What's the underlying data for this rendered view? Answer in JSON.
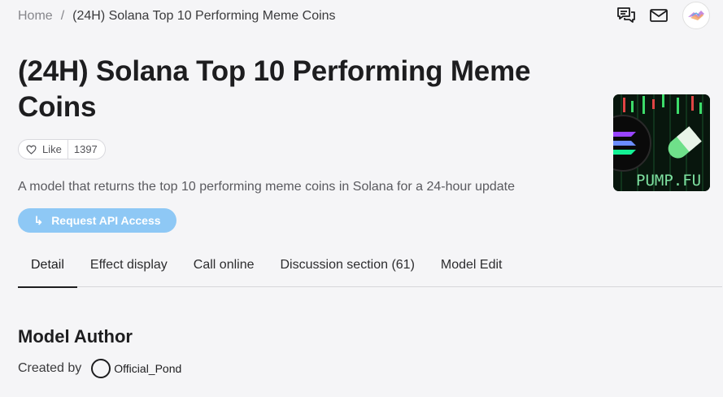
{
  "breadcrumb": {
    "home": "Home",
    "separator": "/",
    "current": "(24H) Solana Top 10 Performing Meme Coins"
  },
  "header": {
    "icons": [
      "chat-icon",
      "mail-icon",
      "user-avatar"
    ]
  },
  "model": {
    "title": "(24H) Solana Top 10 Performing Meme Coins",
    "like_label": "Like",
    "like_count": "1397",
    "description": "A model that returns the top 10 performing meme coins in Solana for a 24-hour update",
    "api_button": "Request API Access",
    "thumbnail_text": "PUMP.FU"
  },
  "tabs": [
    {
      "label": "Detail",
      "active": true
    },
    {
      "label": "Effect display",
      "active": false
    },
    {
      "label": "Call online",
      "active": false
    },
    {
      "label": "Discussion section (61)",
      "active": false
    },
    {
      "label": "Model Edit",
      "active": false
    }
  ],
  "author_section": {
    "title": "Model Author",
    "created_by": "Created by",
    "author_name": "Official_Pond"
  },
  "colors": {
    "accent": "#8ec8f5",
    "background": "#f5f5f7",
    "text": "#1d1d1f"
  }
}
